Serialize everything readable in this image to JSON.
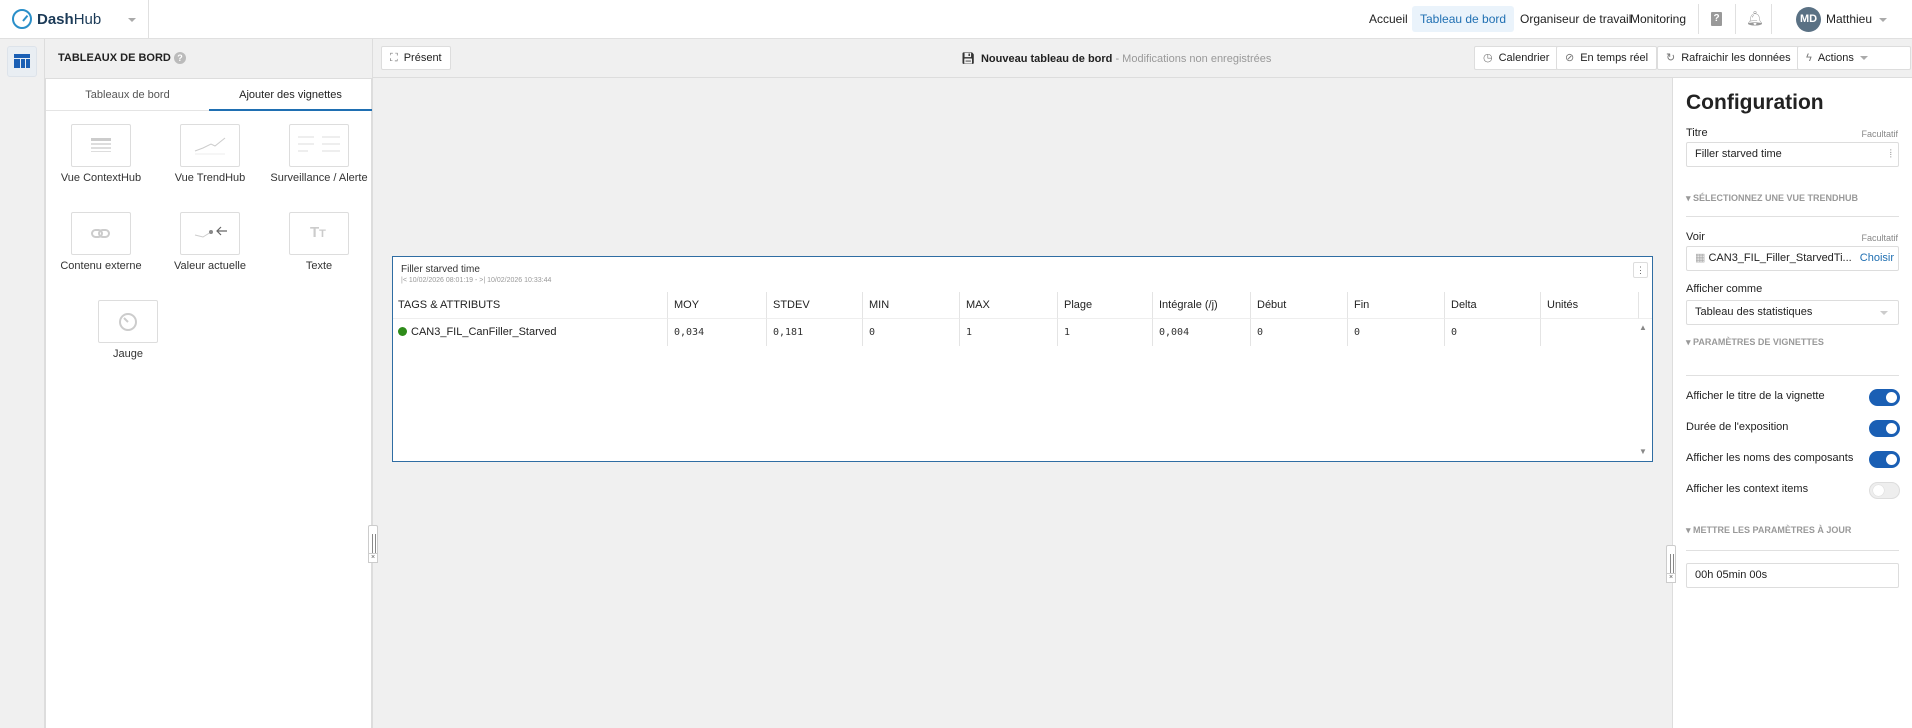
{
  "header": {
    "brand_bold": "Dash",
    "brand_light": "Hub",
    "nav": [
      "Accueil",
      "Tableau de bord",
      "Organiseur de travail",
      "Monitoring"
    ],
    "active_nav": "Tableau de bord",
    "avatar_initials": "MD",
    "user": "Matthieu"
  },
  "left_panel": {
    "title": "TABLEAUX DE BORD",
    "tabs": [
      "Tableaux de bord",
      "Ajouter des vignettes"
    ],
    "tiles": [
      "Vue ContextHub",
      "Vue TrendHub",
      "Surveillance / Alerte",
      "Contenu externe",
      "Valeur actuelle",
      "Texte",
      "Jauge"
    ]
  },
  "toolbar": {
    "present": "Présent",
    "dashboard_name": "Nouveau tableau de bord",
    "unsaved": " - Modifications non enregistrées",
    "calendar": "Calendrier",
    "realtime": "En temps réel",
    "refresh": "Rafraichir les données",
    "actions": "Actions"
  },
  "widget": {
    "title": "Filler starved time",
    "range": "|< 10/02/2026 08:01:19 - >| 10/02/2026 10:33:44",
    "columns": [
      "TAGS & ATTRIBUTS",
      "MOY",
      "STDEV",
      "MIN",
      "MAX",
      "Plage",
      "Intégrale (/j)",
      "Début",
      "Fin",
      "Delta",
      "Unités"
    ],
    "rows": [
      [
        "CAN3_FIL_CanFiller_Starved",
        "0,034",
        "0,181",
        "0",
        "1",
        "1",
        "0,004",
        "0",
        "0",
        "0",
        ""
      ]
    ],
    "row_color": "#2e8b1a"
  },
  "config": {
    "heading": "Configuration",
    "title_label": "Titre",
    "optional": "Facultatif",
    "title_value": "Filler starved time",
    "section_view": "SÉLECTIONNEZ UNE VUE TRENDHUB",
    "view_label": "Voir",
    "view_value": "CAN3_FIL_Filler_StarvedTi...",
    "choose": "Choisir",
    "display_as_label": "Afficher comme",
    "display_as_value": "Tableau des statistiques",
    "section_tile": "PARAMÈTRES DE VIGNETTES",
    "toggles": [
      {
        "label": "Afficher le titre de la vignette",
        "on": true
      },
      {
        "label": "Durée de l'exposition",
        "on": true
      },
      {
        "label": "Afficher les noms des composants",
        "on": true
      },
      {
        "label": "Afficher les context items",
        "on": false
      }
    ],
    "section_update": "METTRE LES PARAMÈTRES À JOUR",
    "update_value": "00h 05min 00s"
  },
  "colors": {
    "accent": "#1a5fb4",
    "widget_border": "#2f6da3"
  }
}
